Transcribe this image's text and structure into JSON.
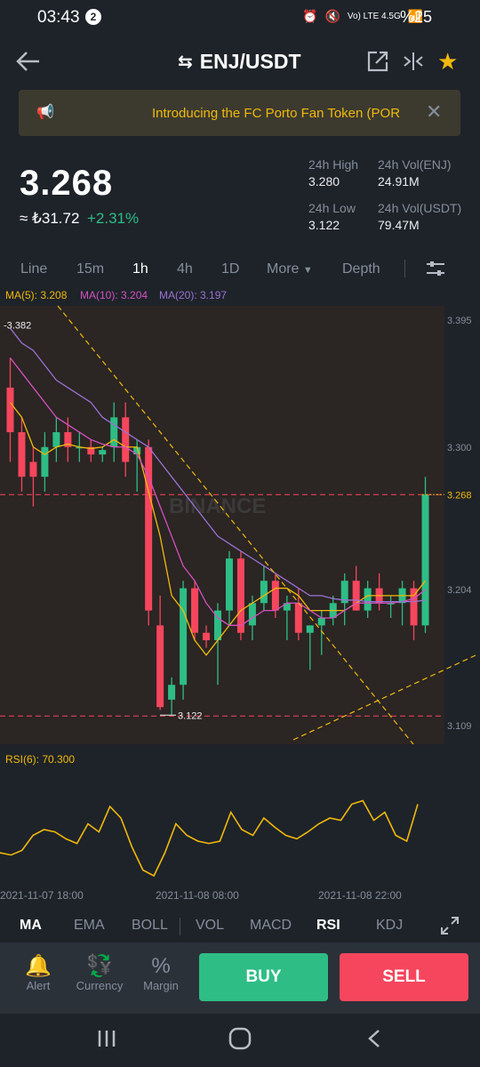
{
  "status": {
    "time": "03:43",
    "badge": "2",
    "network": "Vo) LTE 4.5G",
    "battery": "%25"
  },
  "header": {
    "pair": "ENJ/USDT"
  },
  "banner": {
    "text": "Introducing the FC Porto Fan Token (POR"
  },
  "ticker": {
    "price": "3.268",
    "fiat": "≈ ₺31.72",
    "change": "+2.31%",
    "high_label": "24h High",
    "high": "3.280",
    "low_label": "24h Low",
    "low": "3.122",
    "vol_enj_label": "24h Vol(ENJ)",
    "vol_enj": "24.91M",
    "vol_usdt_label": "24h Vol(USDT)",
    "vol_usdt": "79.47M"
  },
  "timeframes": [
    "Line",
    "15m",
    "1h",
    "4h",
    "1D",
    "More",
    "Depth"
  ],
  "active_timeframe": "1h",
  "ma_legend": {
    "ma5": "MA(5): 3.208",
    "ma10": "MA(10): 3.204",
    "ma20": "MA(20): 3.197"
  },
  "chart_data": {
    "type": "candlestick",
    "y_ticks": [
      "3.395",
      "3.300",
      "3.268",
      "3.204",
      "3.109"
    ],
    "ylim": [
      3.109,
      3.395
    ],
    "annotations": {
      "high": "3.382",
      "low": "3.122",
      "last": "3.268"
    },
    "watermark": "BINANCE",
    "candles": [
      {
        "o": 3.34,
        "h": 3.36,
        "l": 3.29,
        "c": 3.31
      },
      {
        "o": 3.31,
        "h": 3.32,
        "l": 3.27,
        "c": 3.28
      },
      {
        "o": 3.29,
        "h": 3.3,
        "l": 3.26,
        "c": 3.28
      },
      {
        "o": 3.28,
        "h": 3.31,
        "l": 3.27,
        "c": 3.3
      },
      {
        "o": 3.3,
        "h": 3.32,
        "l": 3.29,
        "c": 3.31
      },
      {
        "o": 3.31,
        "h": 3.32,
        "l": 3.29,
        "c": 3.3
      },
      {
        "o": 3.3,
        "h": 3.31,
        "l": 3.29,
        "c": 3.3
      },
      {
        "o": 3.3,
        "h": 3.305,
        "l": 3.29,
        "c": 3.295
      },
      {
        "o": 3.295,
        "h": 3.3,
        "l": 3.29,
        "c": 3.298
      },
      {
        "o": 3.3,
        "h": 3.33,
        "l": 3.29,
        "c": 3.32
      },
      {
        "o": 3.32,
        "h": 3.33,
        "l": 3.28,
        "c": 3.29
      },
      {
        "o": 3.295,
        "h": 3.305,
        "l": 3.27,
        "c": 3.3
      },
      {
        "o": 3.3,
        "h": 3.305,
        "l": 3.18,
        "c": 3.19
      },
      {
        "o": 3.18,
        "h": 3.2,
        "l": 3.123,
        "c": 3.125
      },
      {
        "o": 3.13,
        "h": 3.145,
        "l": 3.12,
        "c": 3.14
      },
      {
        "o": 3.14,
        "h": 3.21,
        "l": 3.13,
        "c": 3.205
      },
      {
        "o": 3.205,
        "h": 3.21,
        "l": 3.17,
        "c": 3.175
      },
      {
        "o": 3.175,
        "h": 3.18,
        "l": 3.165,
        "c": 3.17
      },
      {
        "o": 3.17,
        "h": 3.195,
        "l": 3.14,
        "c": 3.19
      },
      {
        "o": 3.19,
        "h": 3.23,
        "l": 3.18,
        "c": 3.225
      },
      {
        "o": 3.225,
        "h": 3.23,
        "l": 3.17,
        "c": 3.175
      },
      {
        "o": 3.18,
        "h": 3.2,
        "l": 3.17,
        "c": 3.195
      },
      {
        "o": 3.195,
        "h": 3.22,
        "l": 3.19,
        "c": 3.21
      },
      {
        "o": 3.21,
        "h": 3.215,
        "l": 3.185,
        "c": 3.19
      },
      {
        "o": 3.19,
        "h": 3.2,
        "l": 3.17,
        "c": 3.195
      },
      {
        "o": 3.195,
        "h": 3.205,
        "l": 3.17,
        "c": 3.175
      },
      {
        "o": 3.175,
        "h": 3.18,
        "l": 3.15,
        "c": 3.18
      },
      {
        "o": 3.18,
        "h": 3.19,
        "l": 3.16,
        "c": 3.185
      },
      {
        "o": 3.185,
        "h": 3.2,
        "l": 3.18,
        "c": 3.195
      },
      {
        "o": 3.195,
        "h": 3.215,
        "l": 3.18,
        "c": 3.21
      },
      {
        "o": 3.21,
        "h": 3.22,
        "l": 3.19,
        "c": 3.19
      },
      {
        "o": 3.19,
        "h": 3.21,
        "l": 3.185,
        "c": 3.205
      },
      {
        "o": 3.205,
        "h": 3.215,
        "l": 3.19,
        "c": 3.195
      },
      {
        "o": 3.195,
        "h": 3.2,
        "l": 3.185,
        "c": 3.195
      },
      {
        "o": 3.195,
        "h": 3.21,
        "l": 3.18,
        "c": 3.205
      },
      {
        "o": 3.205,
        "h": 3.21,
        "l": 3.17,
        "c": 3.18
      },
      {
        "o": 3.18,
        "h": 3.28,
        "l": 3.175,
        "c": 3.268
      }
    ],
    "ma5": [
      3.33,
      3.32,
      3.3,
      3.295,
      3.3,
      3.302,
      3.3,
      3.299,
      3.3,
      3.305,
      3.3,
      3.3,
      3.27,
      3.24,
      3.2,
      3.19,
      3.17,
      3.16,
      3.17,
      3.18,
      3.19,
      3.195,
      3.2,
      3.205,
      3.205,
      3.2,
      3.19,
      3.19,
      3.19,
      3.19,
      3.195,
      3.2,
      3.2,
      3.2,
      3.2,
      3.2,
      3.21
    ],
    "ma10": [
      3.36,
      3.35,
      3.34,
      3.33,
      3.32,
      3.315,
      3.31,
      3.305,
      3.302,
      3.3,
      3.3,
      3.295,
      3.28,
      3.26,
      3.24,
      3.22,
      3.21,
      3.195,
      3.185,
      3.18,
      3.18,
      3.185,
      3.19,
      3.19,
      3.195,
      3.195,
      3.19,
      3.185,
      3.185,
      3.19,
      3.195,
      3.195,
      3.195,
      3.195,
      3.196,
      3.198,
      3.204
    ],
    "ma20": [
      3.38,
      3.37,
      3.365,
      3.355,
      3.345,
      3.34,
      3.335,
      3.33,
      3.32,
      3.315,
      3.31,
      3.305,
      3.3,
      3.29,
      3.28,
      3.27,
      3.26,
      3.25,
      3.24,
      3.235,
      3.23,
      3.225,
      3.22,
      3.215,
      3.21,
      3.205,
      3.2,
      3.2,
      3.198,
      3.197,
      3.197,
      3.196,
      3.196,
      3.196,
      3.196,
      3.196,
      3.197
    ]
  },
  "rsi": {
    "label": "RSI(6): 70.300",
    "values": [
      30,
      28,
      32,
      45,
      50,
      48,
      42,
      38,
      55,
      48,
      70,
      60,
      35,
      15,
      10,
      30,
      55,
      45,
      40,
      38,
      40,
      65,
      50,
      45,
      60,
      52,
      45,
      42,
      48,
      55,
      60,
      58,
      72,
      75,
      58,
      65,
      45,
      40,
      72
    ],
    "x_labels": [
      "2021-11-07 18:00",
      "2021-11-08 08:00",
      "2021-11-08 22:00"
    ]
  },
  "indicators": [
    "MA",
    "EMA",
    "BOLL",
    "VOL",
    "MACD",
    "RSI",
    "KDJ"
  ],
  "bottom": {
    "alert": "Alert",
    "currency": "Currency",
    "margin": "Margin",
    "buy": "BUY",
    "sell": "SELL"
  },
  "colors": {
    "green": "#2ebd85",
    "red": "#f6465d",
    "yellow": "#f0b90b",
    "ma10": "#d451c2",
    "ma20": "#9a72d4"
  }
}
